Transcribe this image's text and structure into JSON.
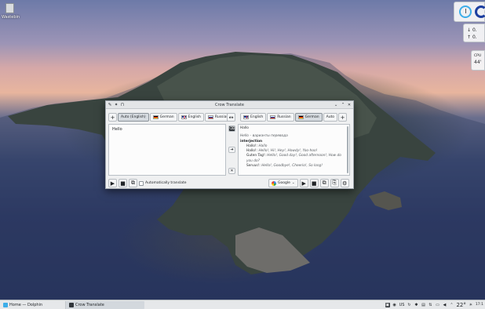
{
  "desktop": {
    "trash_label": "Wastebin",
    "net_down": "0.",
    "net_up": "0.",
    "cpu_label": "CPU",
    "cpu_value": "44'"
  },
  "window": {
    "title": "Crow Translate",
    "source_langs": [
      "Auto (English)",
      "German",
      "English",
      "Russian"
    ],
    "target_langs": [
      "English",
      "Russian",
      "German",
      "Auto"
    ],
    "source_text": "Hello",
    "translation": {
      "word": "Hallo",
      "variants_line": "Hello – варианты перевода",
      "pos": "interjection",
      "entries": [
        {
          "term": "Hallo!:",
          "syn": "Hallo"
        },
        {
          "term": "Hallo!:",
          "syn": "Hello!, Hi!, Hey!, Howdy!, Yoo-hoo!"
        },
        {
          "term": "Guten Tag!:",
          "syn": "Hello!, Good day!, Good afternoon!, How do you do?"
        },
        {
          "term": "Servus!:",
          "syn": "Hello!, Goodbye!, Cheerio!, So long!"
        }
      ]
    },
    "auto_translate_label": "Automatically translate",
    "engine": "Google"
  },
  "taskbar": {
    "tasks": [
      "Home — Dolphin",
      "Crow Translate"
    ],
    "keyboard_layout": "US",
    "temperature": "22°",
    "clock": "17:1"
  }
}
